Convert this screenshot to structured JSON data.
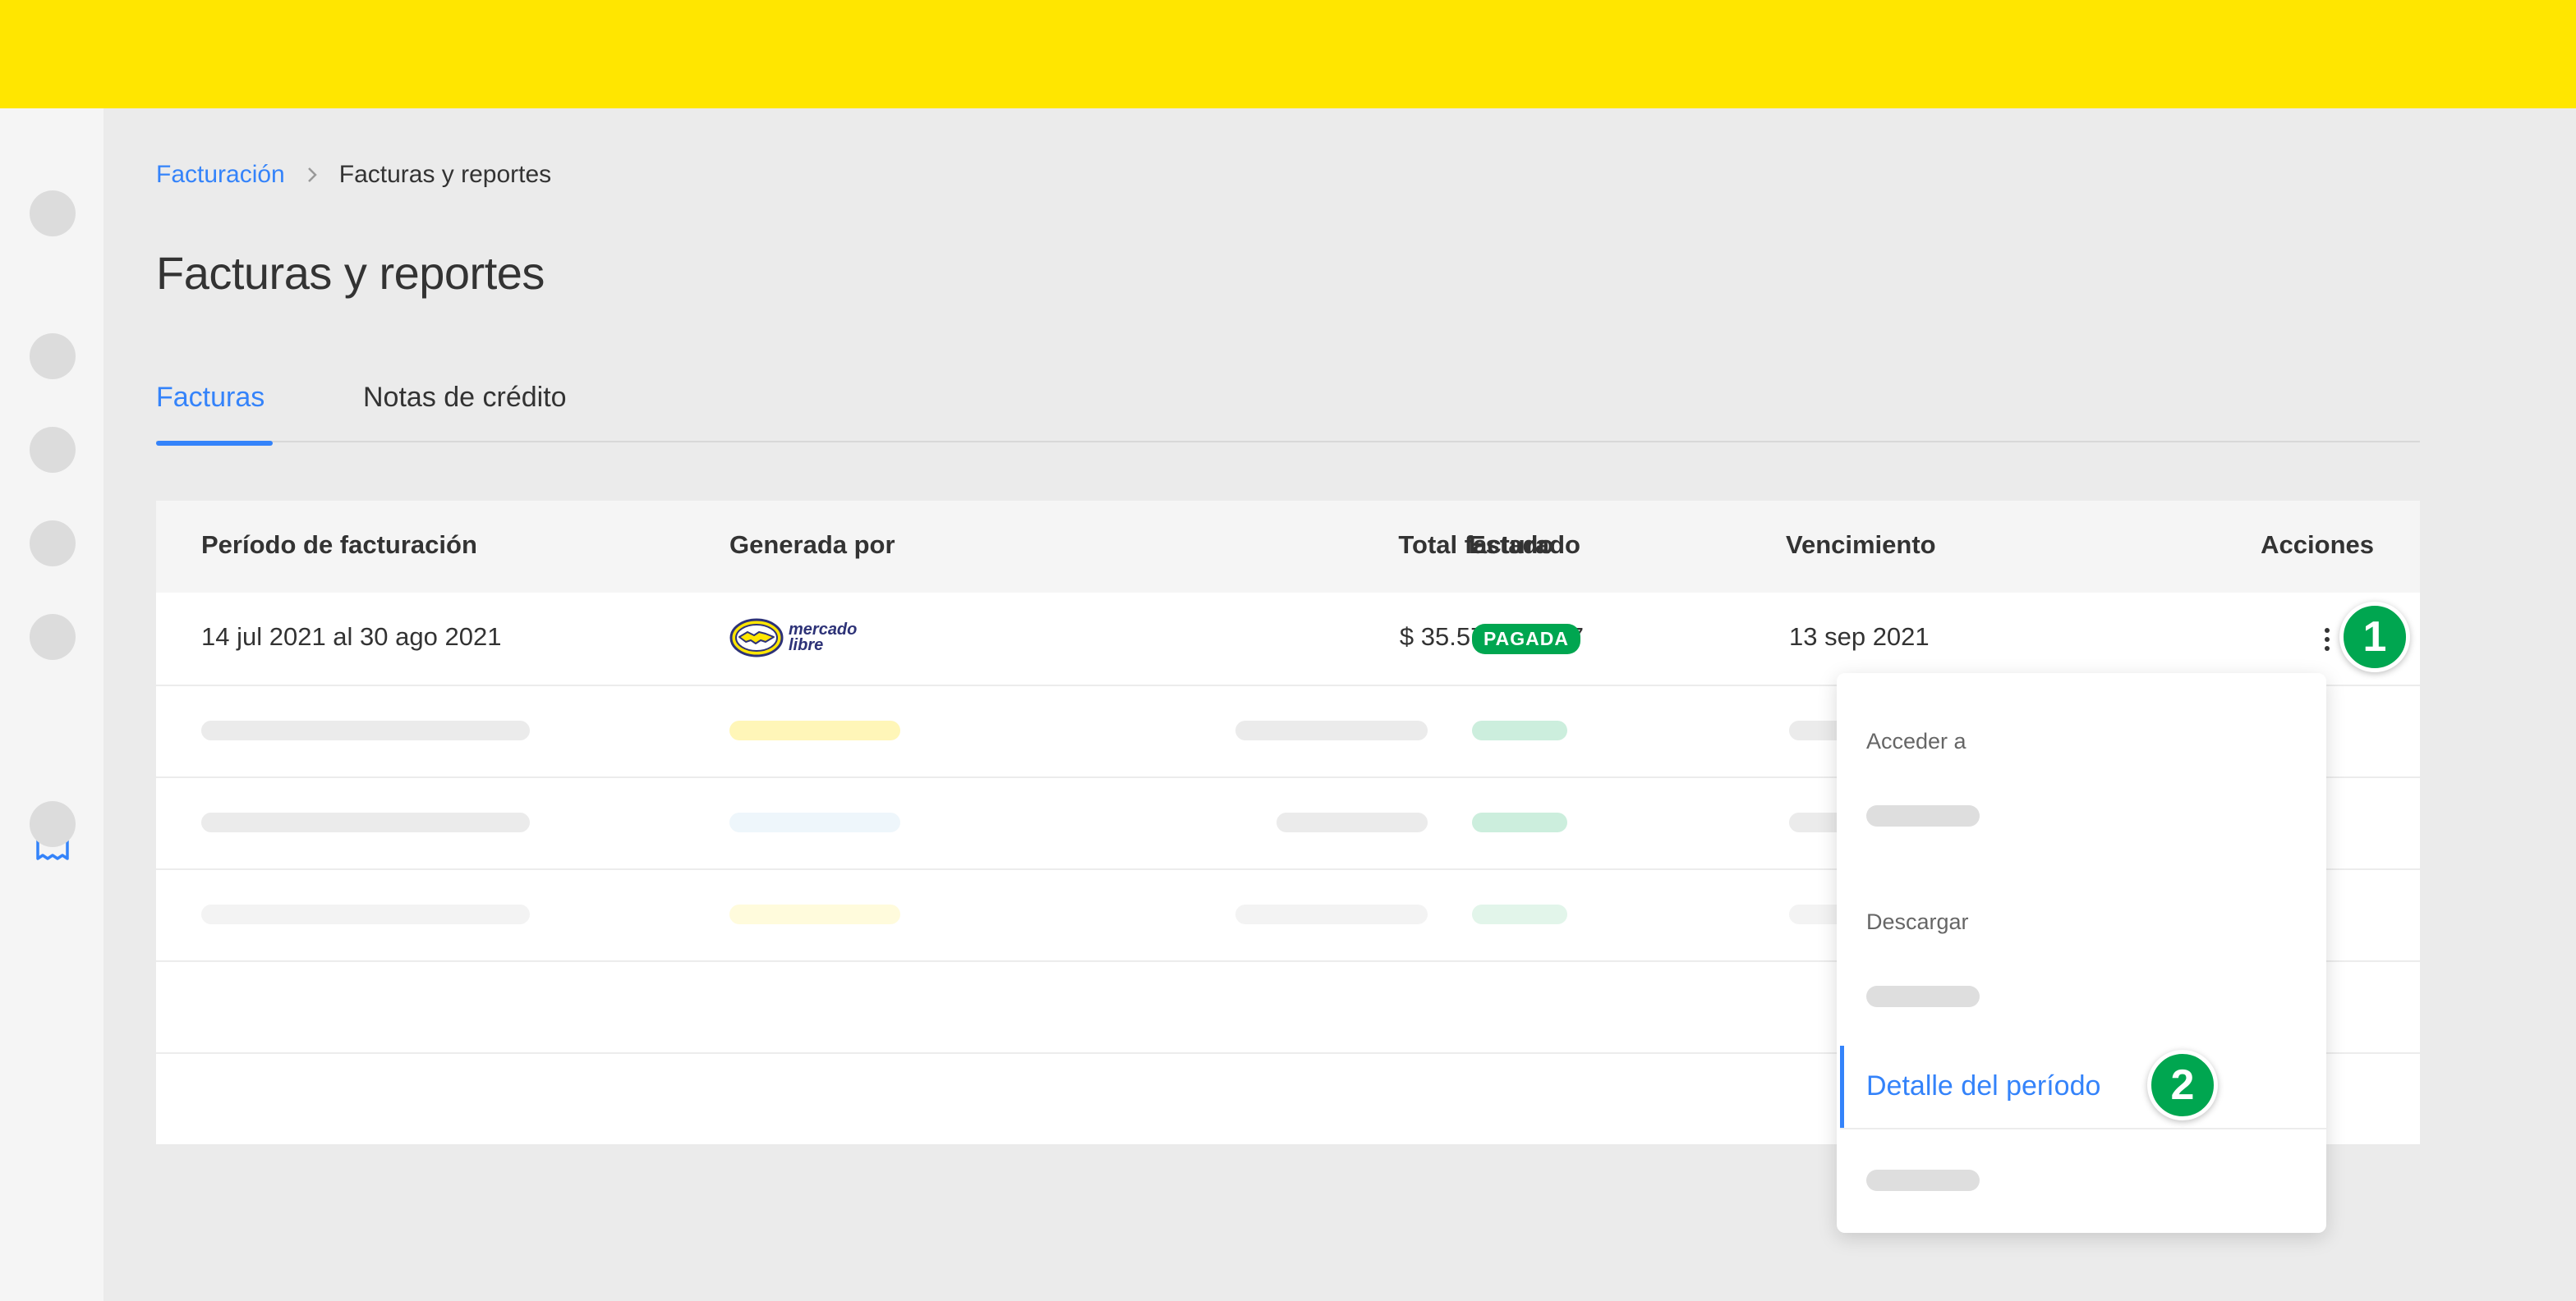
{
  "breadcrumb": {
    "parent": "Facturación",
    "current": "Facturas y reportes"
  },
  "page": {
    "title": "Facturas y reportes"
  },
  "tabs": [
    {
      "label": "Facturas",
      "active": true
    },
    {
      "label": "Notas de crédito",
      "active": false
    }
  ],
  "table": {
    "headers": {
      "period": "Período de facturación",
      "generated_by": "Generada por",
      "total": "Total facturado",
      "status": "Estado",
      "due": "Vencimiento",
      "actions": "Acciones"
    },
    "row": {
      "period": "14 jul 2021 al 30 ago 2021",
      "generated_by_logo": {
        "line1": "mercado",
        "line2": "libre"
      },
      "total": "$ 35.570.306,47",
      "status": "PAGADA",
      "due": "13 sep 2021"
    }
  },
  "menu": {
    "section_access": "Acceder a",
    "section_download": "Descargar",
    "detail_item": "Detalle del período"
  },
  "steps": {
    "one": "1",
    "two": "2"
  },
  "colors": {
    "header_bg": "#ffe600",
    "link_blue": "#3483fa",
    "status_green": "#00a650",
    "logo_navy": "#2d3277"
  },
  "icons": {
    "sidebar_active": "receipt-icon",
    "breadcrumb_sep": "chevron-right-icon",
    "actions": "kebab-menu-icon"
  }
}
